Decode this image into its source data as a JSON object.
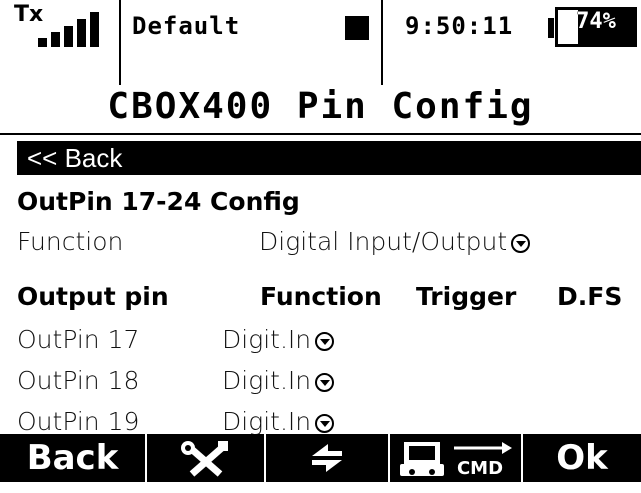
{
  "status": {
    "tx_label": "Tx",
    "signal_bars": 5,
    "model_name": "Default",
    "time": "9:50:11",
    "battery_text": "74%",
    "battery_level": 0.74
  },
  "title": "CBOX400 Pin Config",
  "menu": {
    "back_label": "<< Back",
    "section_title": "OutPin 17-24 Config",
    "function_label": "Function",
    "function_value": "Digital Input/Output"
  },
  "table": {
    "headers": [
      "Output pin",
      "Function",
      "Trigger",
      "D.FS"
    ],
    "rows": [
      {
        "pin": "OutPin 17",
        "function": "Digit.In"
      },
      {
        "pin": "OutPin 18",
        "function": "Digit.In"
      },
      {
        "pin": "OutPin 19",
        "function": "Digit.In"
      }
    ]
  },
  "softkeys": {
    "back": "Back",
    "settings_icon": "wrench-screwdriver-icon",
    "refresh_icon": "swap-arrows-icon",
    "cmd_icon": "device-cmd-icon",
    "cmd_text": "CMD",
    "ok": "Ok"
  }
}
